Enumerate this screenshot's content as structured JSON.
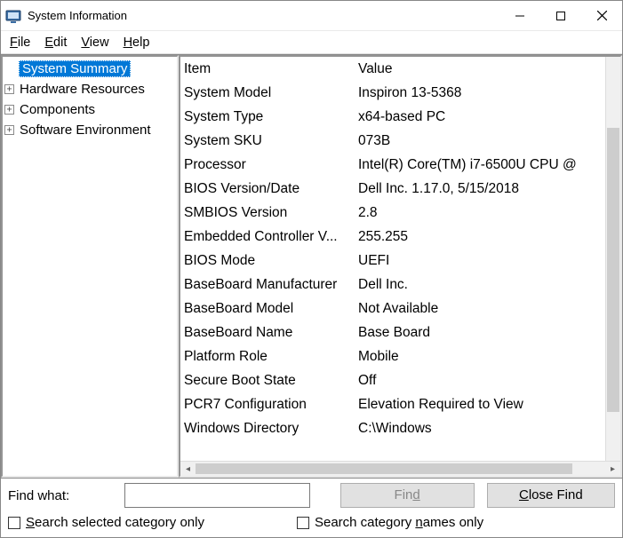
{
  "window": {
    "title": "System Information"
  },
  "menu": {
    "file": "File",
    "edit": "Edit",
    "view": "View",
    "help": "Help"
  },
  "tree": {
    "items": [
      {
        "label": "System Summary",
        "expandable": false,
        "selected": true
      },
      {
        "label": "Hardware Resources",
        "expandable": true,
        "selected": false
      },
      {
        "label": "Components",
        "expandable": true,
        "selected": false
      },
      {
        "label": "Software Environment",
        "expandable": true,
        "selected": false
      }
    ]
  },
  "list": {
    "header_item": "Item",
    "header_value": "Value",
    "rows": [
      {
        "item": "System Model",
        "value": "Inspiron 13-5368"
      },
      {
        "item": "System Type",
        "value": "x64-based PC"
      },
      {
        "item": "System SKU",
        "value": "073B"
      },
      {
        "item": "Processor",
        "value": "Intel(R) Core(TM) i7-6500U CPU @"
      },
      {
        "item": "BIOS Version/Date",
        "value": "Dell Inc. 1.17.0, 5/15/2018"
      },
      {
        "item": "SMBIOS Version",
        "value": "2.8"
      },
      {
        "item": "Embedded Controller V...",
        "value": "255.255"
      },
      {
        "item": "BIOS Mode",
        "value": "UEFI"
      },
      {
        "item": "BaseBoard Manufacturer",
        "value": "Dell Inc."
      },
      {
        "item": "BaseBoard Model",
        "value": "Not Available"
      },
      {
        "item": "BaseBoard Name",
        "value": "Base Board"
      },
      {
        "item": "Platform Role",
        "value": "Mobile"
      },
      {
        "item": "Secure Boot State",
        "value": "Off"
      },
      {
        "item": "PCR7 Configuration",
        "value": "Elevation Required to View"
      },
      {
        "item": "Windows Directory",
        "value": "C:\\Windows"
      }
    ]
  },
  "find": {
    "label": "Find what:",
    "value": "",
    "find_btn": "Find",
    "close_btn": "Close Find",
    "check_category": "Search selected category only",
    "check_names": "Search category names only"
  }
}
